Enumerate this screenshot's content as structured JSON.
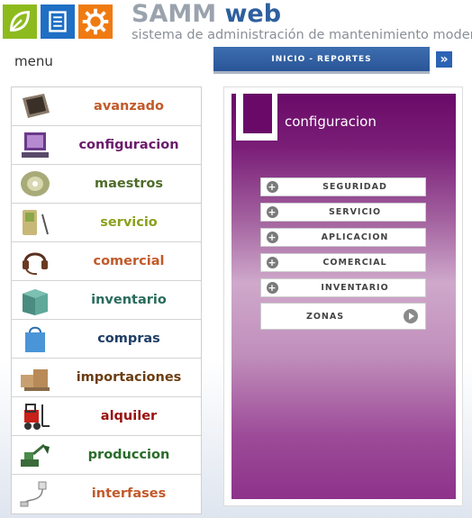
{
  "brand": {
    "samm": "SAMM",
    "web": "web",
    "tagline": "sistema de administración de mantenimiento moderno"
  },
  "menu_title": "menu",
  "topnav": {
    "inicio": "INICIO",
    "separator": "-",
    "reportes": "REPORTES",
    "arrow_icon": "double-chevron-right-icon"
  },
  "menu": {
    "items": [
      {
        "label": "avanzado",
        "color": "#c25a2a",
        "icon": "tablet-icon"
      },
      {
        "label": "configuracion",
        "color": "#6b1a6b",
        "icon": "computer-monitor-icon"
      },
      {
        "label": "maestros",
        "color": "#4f6b2a",
        "icon": "cd-disc-icon"
      },
      {
        "label": "servicio",
        "color": "#8aa01e",
        "icon": "pda-icon"
      },
      {
        "label": "comercial",
        "color": "#c25a2a",
        "icon": "headset-icon"
      },
      {
        "label": "inventario",
        "color": "#2a6b5a",
        "icon": "box-icon"
      },
      {
        "label": "compras",
        "color": "#1f3f66",
        "icon": "shopping-bag-icon"
      },
      {
        "label": "importaciones",
        "color": "#6b3d12",
        "icon": "shipping-boxes-icon"
      },
      {
        "label": "alquiler",
        "color": "#9a1010",
        "icon": "forklift-icon"
      },
      {
        "label": "produccion",
        "color": "#2a6b2a",
        "icon": "excavator-icon"
      },
      {
        "label": "interfases",
        "color": "#c25a2a",
        "icon": "connector-icon"
      }
    ]
  },
  "panel": {
    "title": "configuracion",
    "submenu": [
      {
        "label": "SEGURIDAD"
      },
      {
        "label": "SERVICIO"
      },
      {
        "label": "APLICACION"
      },
      {
        "label": "COMERCIAL"
      },
      {
        "label": "INVENTARIO"
      }
    ],
    "zonas": "ZONAS"
  },
  "colors": {
    "panel_purple": "#6a0a68",
    "nav_blue": "#2a5597"
  }
}
